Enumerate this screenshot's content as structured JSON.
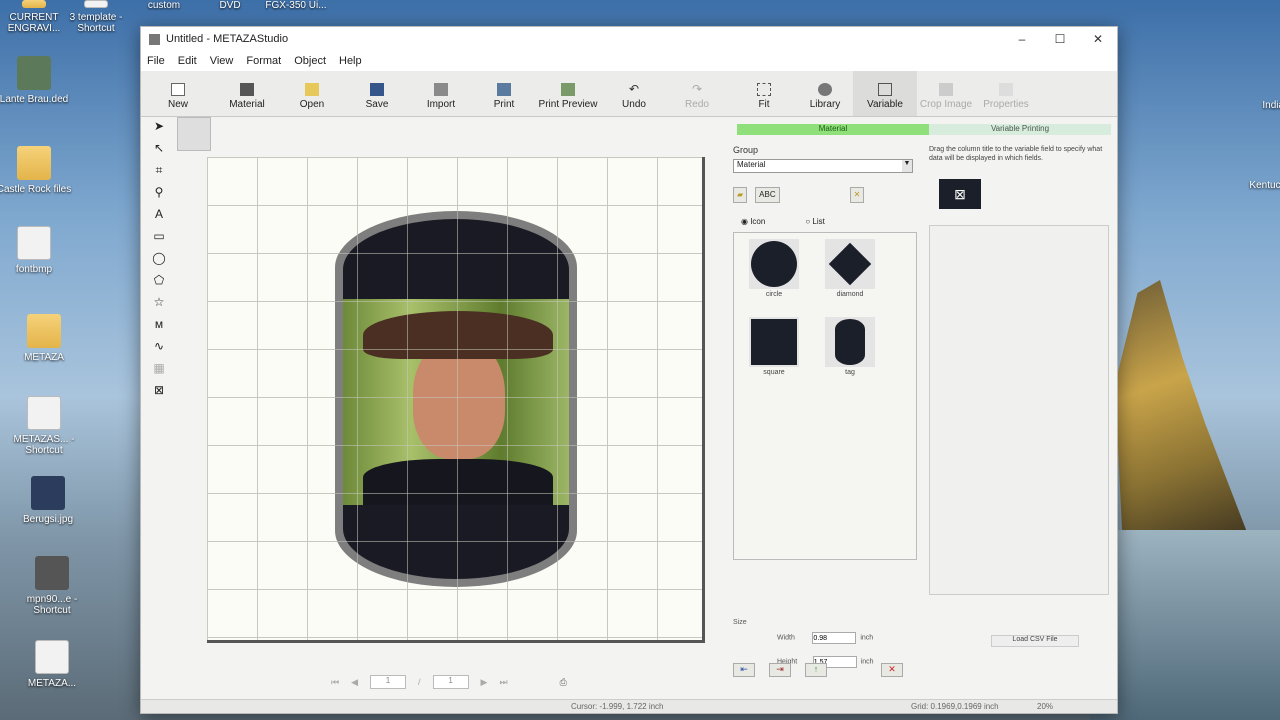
{
  "desktop": {
    "icons": [
      {
        "label": "CURRENT ENGRAVI..."
      },
      {
        "label": "3 template - Shortcut"
      },
      {
        "label": "custom"
      },
      {
        "label": "DVD"
      },
      {
        "label": "FGX-350 Ui..."
      },
      {
        "label": "Lante Brau.ded"
      },
      {
        "label": "Castle Rock files"
      },
      {
        "label": "fontbmp"
      },
      {
        "label": "METAZA"
      },
      {
        "label": "METAZAS... - Shortcut"
      },
      {
        "label": "Berugsi.jpg"
      },
      {
        "label": "mpn90...e - Shortcut"
      },
      {
        "label": "METAZA..."
      },
      {
        "label": "Indian"
      },
      {
        "label": "Kentucky"
      }
    ]
  },
  "window": {
    "title": "Untitled - METAZAStudio",
    "controls": [
      "–",
      "☐",
      "✕"
    ]
  },
  "menu": [
    "File",
    "Edit",
    "View",
    "Format",
    "Object",
    "Help"
  ],
  "toolbar": {
    "new": "New",
    "material": "Material",
    "open": "Open",
    "save": "Save",
    "import": "Import",
    "print": "Print",
    "print_preview": "Print Preview",
    "undo": "Undo",
    "redo": "Redo",
    "fit": "Fit",
    "library": "Library",
    "variable": "Variable",
    "crop_image": "Crop Image",
    "properties": "Properties"
  },
  "tabs": {
    "material": "Material",
    "variable": "Variable Printing"
  },
  "material_panel": {
    "group_label": "Group",
    "group_value": "Material",
    "abc_button": "ABC",
    "view_icon": "Icon",
    "view_list": "List",
    "shapes": [
      {
        "name": "circle"
      },
      {
        "name": "diamond"
      },
      {
        "name": "square"
      },
      {
        "name": "tag"
      }
    ],
    "size_label": "Size",
    "width_label": "Width",
    "width_value": "0.98",
    "height_label": "Height",
    "height_value": "1.57",
    "unit": "inch"
  },
  "variable_panel": {
    "hint": "Drag the column title to the variable field to specify what data will be displayed in which fields.",
    "load_csv": "Load CSV File"
  },
  "navigation": {
    "page_current": "1",
    "page_separator": "/",
    "page_total": "1"
  },
  "status": {
    "cursor": "Cursor: -1.999, 1.722 inch",
    "grid": "Grid: 0.1969,0.1969 inch",
    "zoom": "20%"
  }
}
